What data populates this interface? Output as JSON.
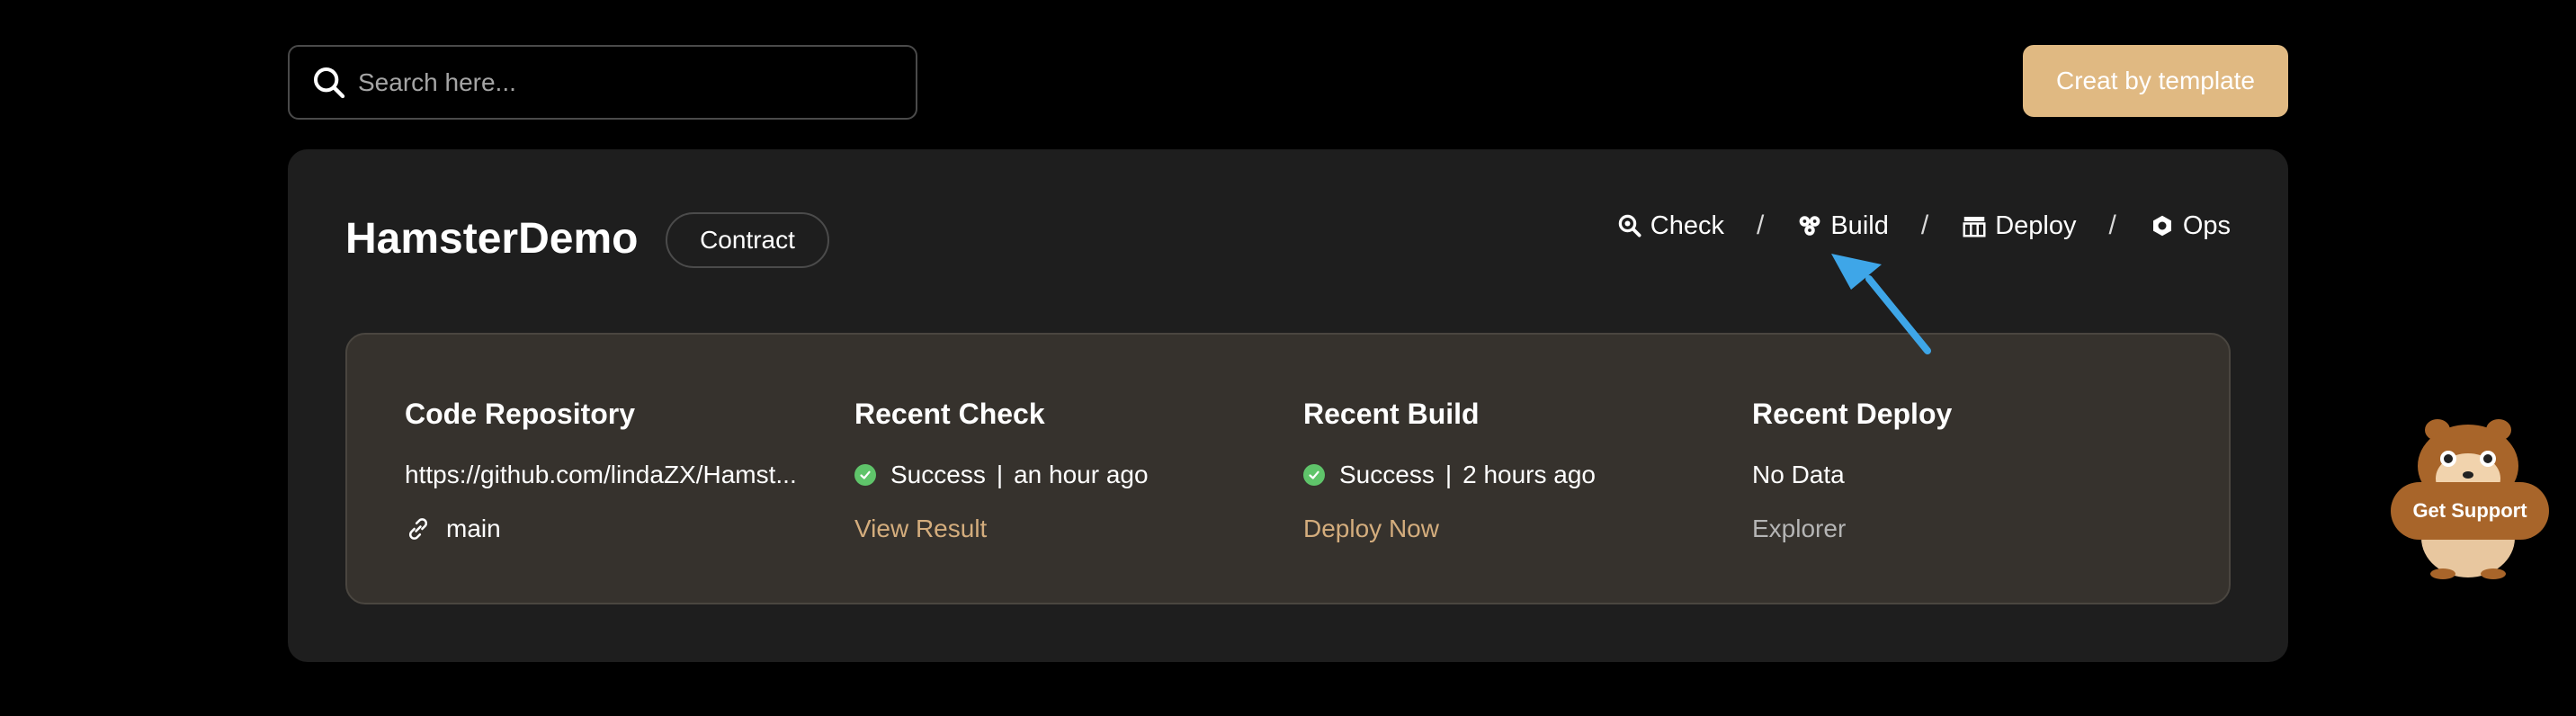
{
  "search": {
    "placeholder": "Search here..."
  },
  "header": {
    "create_button": "Creat by template"
  },
  "project": {
    "name": "HamsterDemo",
    "tag": "Contract",
    "steps": [
      {
        "label": "Check",
        "icon": "magnifier-icon"
      },
      {
        "label": "Build",
        "icon": "cubes-icon"
      },
      {
        "label": "Deploy",
        "icon": "deploy-icon"
      },
      {
        "label": "Ops",
        "icon": "ops-icon"
      }
    ],
    "separator": "/"
  },
  "summary": {
    "repo": {
      "title": "Code Repository",
      "url": "https://github.com/lindaZX/Hamst...",
      "branch": "main"
    },
    "check": {
      "title": "Recent Check",
      "status": "Success",
      "time": "an hour ago",
      "action": "View Result"
    },
    "build": {
      "title": "Recent Build",
      "status": "Success",
      "time": "2 hours ago",
      "action": "Deploy Now"
    },
    "deploy": {
      "title": "Recent Deploy",
      "status": "No Data",
      "action": "Explorer"
    }
  },
  "support": {
    "label": "Get Support"
  },
  "colors": {
    "accent": "#e0b982",
    "link": "#d4ad7d",
    "success": "#5fc46a",
    "card": "#1e1e1e",
    "panel": "#36322d",
    "annotation_arrow": "#3ea6e8"
  }
}
